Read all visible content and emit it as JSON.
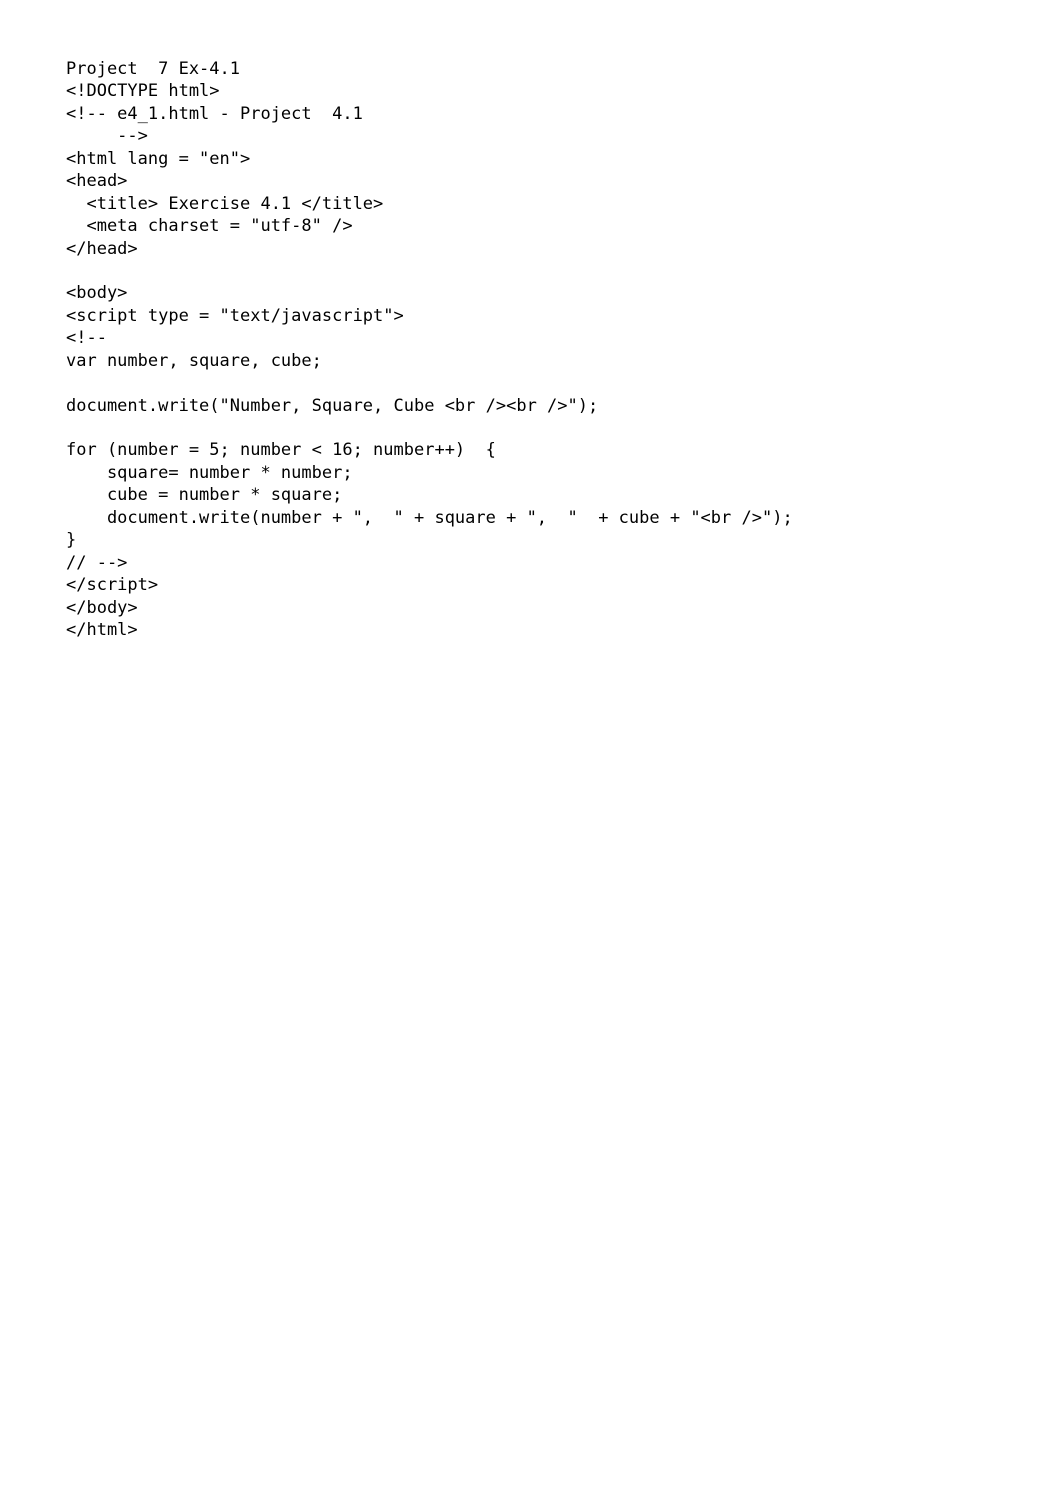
{
  "document": {
    "title_line": "Project  7 Ex-4.1",
    "lines": [
      "Project  7 Ex-4.1",
      "<!DOCTYPE html>",
      "<!-- e4_1.html - Project  4.1",
      "     -->",
      "<html lang = \"en\">",
      "<head>",
      "  <title> Exercise 4.1 </title>",
      "  <meta charset = \"utf-8\" />",
      "</head>",
      "",
      "<body>",
      "<script type = \"text/javascript\">",
      "<!--",
      "var number, square, cube;",
      "",
      "document.write(\"Number, Square, Cube <br /><br />\");",
      "",
      "for (number = 5; number < 16; number++)  {",
      "    square= number * number;",
      "    cube = number * square;",
      "    document.write(number + \",  \" + square + \",  \"  + cube + \"<br />\");",
      "}",
      "// -->",
      "</script>",
      "</body>",
      "</html>"
    ]
  }
}
